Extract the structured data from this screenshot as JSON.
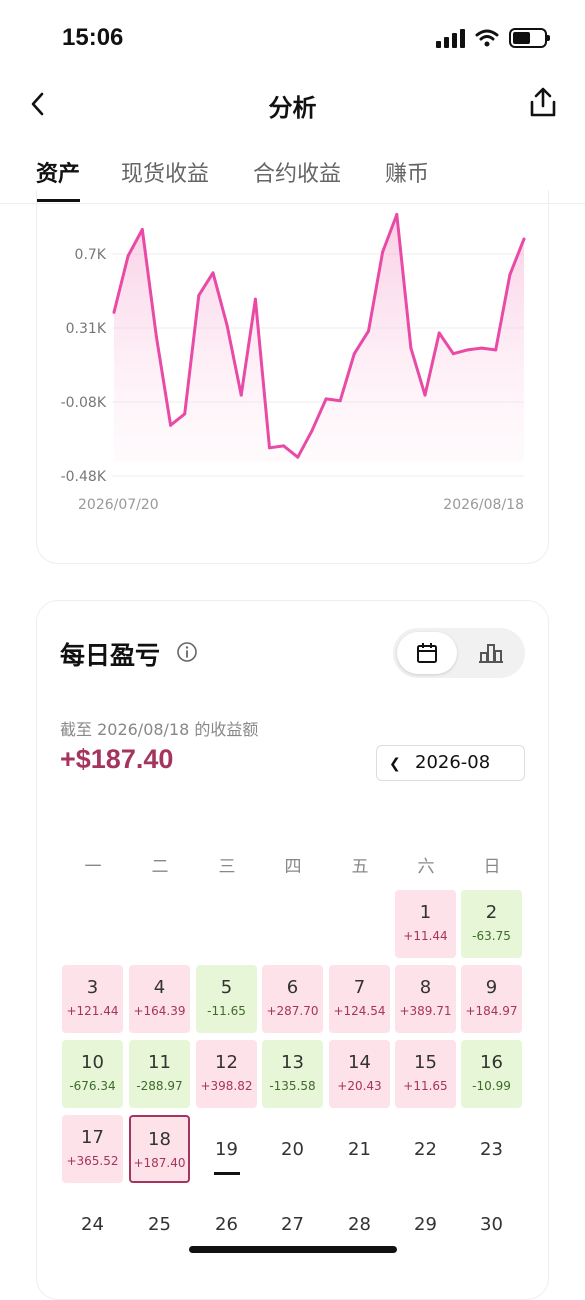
{
  "status_bar": {
    "time": "15:06"
  },
  "nav": {
    "title": "分析"
  },
  "tabs": [
    {
      "label": "资产",
      "active": true
    },
    {
      "label": "现货收益",
      "active": false
    },
    {
      "label": "合约收益",
      "active": false
    },
    {
      "label": "赚币",
      "active": false
    }
  ],
  "chart_data": {
    "type": "area",
    "color": "#e84aa6",
    "y_ticks": [
      "0.7K",
      "0.31K",
      "-0.08K",
      "-0.48K"
    ],
    "ylim": [
      -0.48,
      0.7
    ],
    "x_start_label": "2026/07/20",
    "x_end_label": "2026/08/18",
    "x": [
      "2026/07/20",
      "2026/07/21",
      "2026/07/22",
      "2026/07/23",
      "2026/07/24",
      "2026/07/25",
      "2026/07/26",
      "2026/07/27",
      "2026/07/28",
      "2026/07/29",
      "2026/07/30",
      "2026/07/31",
      "2026/08/01",
      "2026/08/02",
      "2026/08/03",
      "2026/08/04",
      "2026/08/05",
      "2026/08/06",
      "2026/08/07",
      "2026/08/08",
      "2026/08/09",
      "2026/08/10",
      "2026/08/11",
      "2026/08/12",
      "2026/08/13",
      "2026/08/14",
      "2026/08/15",
      "2026/08/16",
      "2026/08/17",
      "2026/08/18"
    ],
    "values": [
      0.39,
      0.69,
      0.83,
      0.26,
      -0.21,
      -0.15,
      0.48,
      0.6,
      0.32,
      -0.05,
      0.46,
      -0.33,
      -0.32,
      -0.38,
      -0.24,
      -0.07,
      -0.08,
      0.17,
      0.29,
      0.71,
      0.91,
      0.2,
      -0.05,
      0.28,
      0.17,
      0.19,
      0.2,
      0.19,
      0.59,
      0.78
    ]
  },
  "daily_pnl": {
    "title": "每日盈亏",
    "subtitle": "截至 2026/08/18 的收益额",
    "total": "+$187.40",
    "month": "2026-08",
    "weekdays": [
      "一",
      "二",
      "三",
      "四",
      "五",
      "六",
      "日"
    ],
    "days": [
      {
        "day": "1",
        "value": "+11.44",
        "kind": "pos"
      },
      {
        "day": "2",
        "value": "-63.75",
        "kind": "neg"
      },
      {
        "day": "3",
        "value": "+121.44",
        "kind": "pos"
      },
      {
        "day": "4",
        "value": "+164.39",
        "kind": "pos"
      },
      {
        "day": "5",
        "value": "-11.65",
        "kind": "neg"
      },
      {
        "day": "6",
        "value": "+287.70",
        "kind": "pos"
      },
      {
        "day": "7",
        "value": "+124.54",
        "kind": "pos"
      },
      {
        "day": "8",
        "value": "+389.71",
        "kind": "pos"
      },
      {
        "day": "9",
        "value": "+184.97",
        "kind": "pos"
      },
      {
        "day": "10",
        "value": "-676.34",
        "kind": "neg"
      },
      {
        "day": "11",
        "value": "-288.97",
        "kind": "neg"
      },
      {
        "day": "12",
        "value": "+398.82",
        "kind": "pos"
      },
      {
        "day": "13",
        "value": "-135.58",
        "kind": "neg"
      },
      {
        "day": "14",
        "value": "+20.43",
        "kind": "pos"
      },
      {
        "day": "15",
        "value": "+11.65",
        "kind": "pos"
      },
      {
        "day": "16",
        "value": "-10.99",
        "kind": "neg"
      },
      {
        "day": "17",
        "value": "+365.52",
        "kind": "pos"
      },
      {
        "day": "18",
        "value": "+187.40",
        "kind": "pos",
        "selected": true
      },
      {
        "day": "19",
        "value": "",
        "kind": "plain",
        "today": true
      },
      {
        "day": "20",
        "value": "",
        "kind": "plain"
      },
      {
        "day": "21",
        "value": "",
        "kind": "plain"
      },
      {
        "day": "22",
        "value": "",
        "kind": "plain"
      },
      {
        "day": "23",
        "value": "",
        "kind": "plain"
      },
      {
        "day": "24",
        "value": "",
        "kind": "plain"
      },
      {
        "day": "25",
        "value": "",
        "kind": "plain"
      },
      {
        "day": "26",
        "value": "",
        "kind": "plain"
      },
      {
        "day": "27",
        "value": "",
        "kind": "plain"
      },
      {
        "day": "28",
        "value": "",
        "kind": "plain"
      },
      {
        "day": "29",
        "value": "",
        "kind": "plain"
      },
      {
        "day": "30",
        "value": "",
        "kind": "plain"
      }
    ]
  }
}
